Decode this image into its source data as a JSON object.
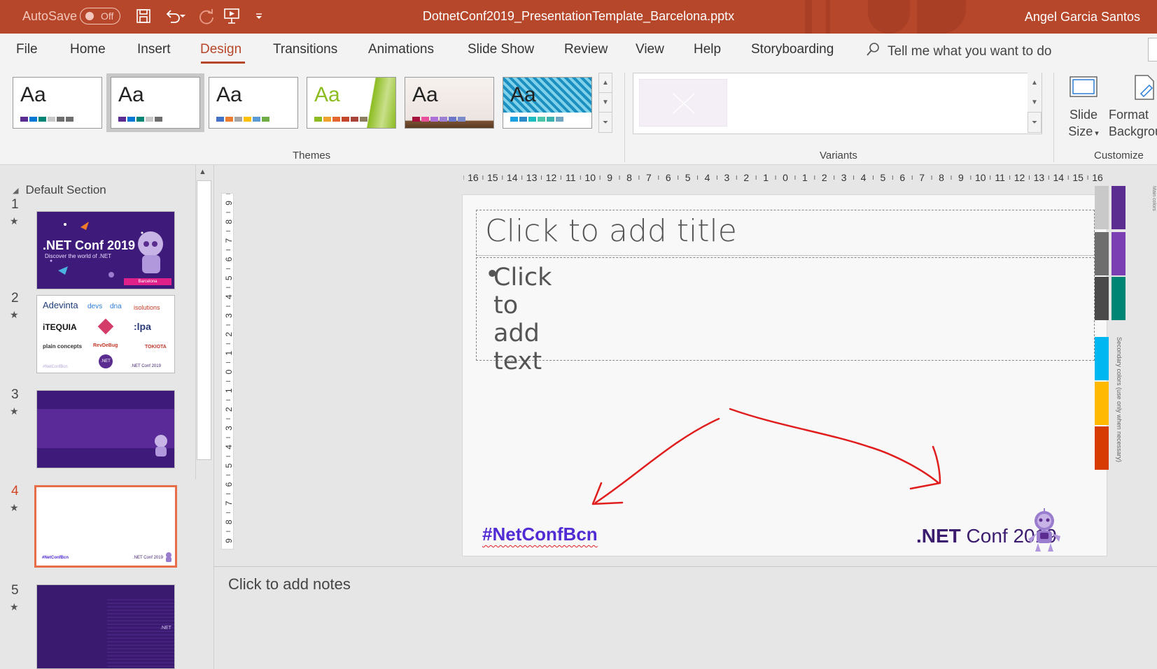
{
  "titlebar": {
    "autosave_label": "AutoSave",
    "autosave_state": "Off",
    "document_title": "DotnetConf2019_PresentationTemplate_Barcelona.pptx",
    "user_name": "Angel Garcia Santos"
  },
  "tabs": [
    {
      "label": "File"
    },
    {
      "label": "Home"
    },
    {
      "label": "Insert"
    },
    {
      "label": "Design",
      "active": true
    },
    {
      "label": "Transitions"
    },
    {
      "label": "Animations"
    },
    {
      "label": "Slide Show"
    },
    {
      "label": "Review"
    },
    {
      "label": "View"
    },
    {
      "label": "Help"
    },
    {
      "label": "Storyboarding"
    }
  ],
  "tell_me": "Tell me what you want to do",
  "ribbon": {
    "themes_label": "Themes",
    "theme_tiles": [
      {
        "text": "Aa",
        "colors": [
          "#5c2d91",
          "#0078d4",
          "#008575",
          "#c8c8c8",
          "#6e6e6e",
          "#6e6e6e"
        ]
      },
      {
        "text": "Aa",
        "colors": [
          "#5c2d91",
          "#0078d4",
          "#008575",
          "#c8c8c8",
          "#6e6e6e"
        ]
      },
      {
        "text": "Aa",
        "colors": [
          "#4472c4",
          "#ed7d31",
          "#a5a5a5",
          "#ffc000",
          "#5b9bd5",
          "#70ad47"
        ]
      },
      {
        "text": "Aa",
        "colors": [
          "#8cbc21",
          "#f0a22e",
          "#e3672e",
          "#c3472c",
          "#a8453a",
          "#8e7d5f"
        ]
      },
      {
        "text": "Aa",
        "colors": [
          "#a5133c",
          "#e85199",
          "#ad70d6",
          "#9d7fd4",
          "#6c78c7",
          "#7a8bc7"
        ]
      },
      {
        "text": "Aa",
        "colors": [
          "#1ba1e2",
          "#2e8bc9",
          "#1bbdc3",
          "#4cc6a8",
          "#3cb1ad",
          "#6fa7c3"
        ]
      }
    ],
    "variants_label": "Variants",
    "customize_label": "Customize",
    "slide_size_line1": "Slide",
    "slide_size_line2": "Size",
    "format_bg_line1": "Format",
    "format_bg_line2": "Background"
  },
  "left_pane": {
    "section_label": "Default Section",
    "slides": [
      {
        "number": "1",
        "title": ".NET Conf 2019",
        "subtitle": "Discover the world of .NET",
        "badge": "Barcelona"
      },
      {
        "number": "2",
        "logos": [
          "Adevinta",
          "devs",
          "dna",
          "isolutions",
          "iTEQUIA",
          ":lpa",
          "plain concepts",
          "RevDeBug",
          "TOKIOTA",
          ".NET"
        ],
        "footer_left": "#NetConfBcn",
        "footer_right": ".NET Conf 2019"
      },
      {
        "number": "3"
      },
      {
        "number": "4",
        "active": true,
        "footer_left": "#NetConfBcn",
        "footer_right": ".NET Conf 2019"
      },
      {
        "number": "5",
        "badge": ".NET"
      }
    ]
  },
  "ruler": {
    "horizontal": "16 15 14 13 12 11 10 9 8 7 6 5 4 3 2 1 0 1 2 3 4 5 6 7 8 9 10 11 12 13 14 15 16",
    "vertical": [
      "9",
      "8",
      "7",
      "6",
      "5",
      "4",
      "3",
      "2",
      "1",
      "0",
      "1",
      "2",
      "3",
      "4",
      "5",
      "6",
      "7",
      "8",
      "9"
    ]
  },
  "slide": {
    "title_placeholder": "Click to add title",
    "body_placeholder": "Click to add text",
    "hashtag": "#NetConfBcn",
    "brand_prefix": ".NET",
    "brand_suffix": " Conf 2019",
    "side_note": "Secondary colors (use only when necessary)",
    "side_title": "Main colors",
    "palette_main": [
      "#c9c9c9",
      "#5c2d91",
      "#6e6e6e",
      "#7b3fb3",
      "#4a4a4a",
      "#008575"
    ],
    "palette_secondary": [
      "#00b7f1",
      "#ffb900",
      "#d83b01"
    ]
  },
  "notes_placeholder": "Click to add notes",
  "colors": {
    "accent": "#b7472a",
    "purple": "#512bd4",
    "annotation": "#e01e1e"
  }
}
